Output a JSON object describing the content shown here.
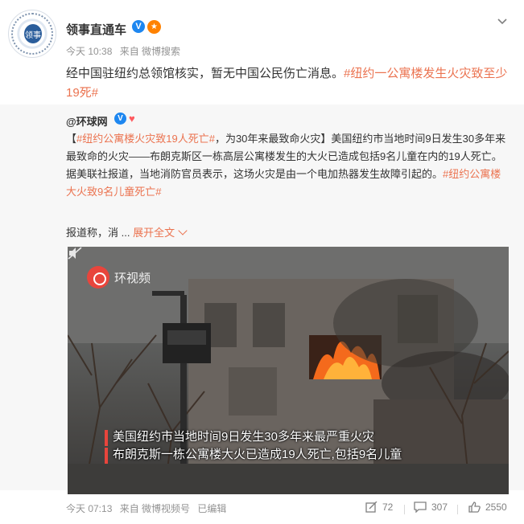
{
  "post": {
    "author": "领事直通车",
    "time": "今天 10:38",
    "source": "来自 微博搜索",
    "text_plain": "经中国驻纽约总领馆核实，暂无中国公民伤亡消息。",
    "hashtag_1": "#纽约一公寓楼发生火灾致至少19死#"
  },
  "avatar": {
    "text": "领事"
  },
  "retweet": {
    "author": "@环球网",
    "bracket_open": "【",
    "hashtag_title": "#纽约公寓楼火灾致19人死亡#",
    "title_rest": "，为30年来最致命火灾",
    "bracket_close": "】",
    "body": "美国纽约市当地时间9日发生30多年来最致命的火灾——布朗克斯区一栋高层公寓楼发生的大火已造成包括9名儿童在内的19人死亡。据美联社报道，当地消防官员表示，这场火灾是由一个电加热器发生故障引起的。",
    "hashtag_end": "#纽约公寓楼大火致9名儿童死亡#",
    "reported_prefix": "报道称，消 ...",
    "expand_label": "展开全文"
  },
  "video": {
    "logo_text": "环视频",
    "caption_line1": "美国纽约市当地时间9日发生30多年来最严重火灾",
    "caption_line2": "布朗克斯一栋公寓楼大火已造成19人死亡,包括9名儿童"
  },
  "footer": {
    "time": "今天 07:13",
    "source": "来自 微博视频号",
    "edited": "已编辑",
    "repost_count": "72",
    "comment_count": "307",
    "like_count": "2550"
  },
  "icons": {
    "verified": "verified-badge-icon",
    "fire": "fire-badge-icon",
    "more": "chevron-down-icon",
    "mute": "mute-icon",
    "repost": "repost-icon",
    "comment": "comment-icon",
    "like": "like-icon"
  },
  "colors": {
    "hashtag": "#eb7350",
    "verified": "#1e87f0",
    "retweet_bg": "#f7f7f7",
    "logo_red": "#e8453c"
  }
}
